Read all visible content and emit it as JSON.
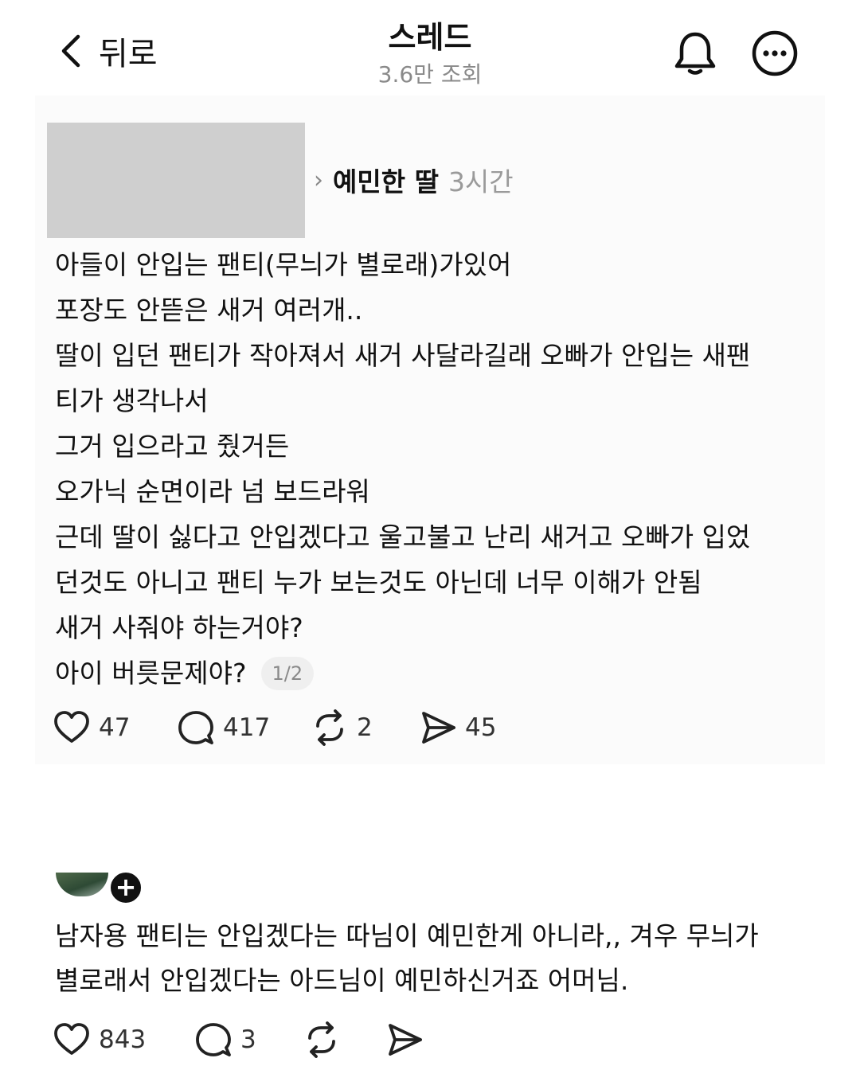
{
  "header": {
    "back_label": "뒤로",
    "title": "스레드",
    "views": "3.6만 조회",
    "bell_icon": "bell-icon",
    "more_icon": "more-icon"
  },
  "post": {
    "author": "예민한 딸",
    "time": "3시간",
    "lines": [
      "아들이 안입는 팬티(무늬가 별로래)가있어",
      "포장도 안뜯은 새거 여러개..",
      "딸이 입던 팬티가 작아져서 새거 사달라길래 오빠가 안입는 새팬",
      "티가 생각나서",
      "그거 입으라고 줬거든",
      "오가닉 순면이라 넘 보드라워",
      "근데 딸이 싫다고 안입겠다고 울고불고 난리 새거고 오빠가 입었",
      "던것도 아니고 팬티 누가 보는것도 아닌데 너무 이해가 안됨",
      "새거 사줘야 하는거야?",
      "아이 버릇문제야?"
    ],
    "page_indicator": "1/2",
    "likes": "47",
    "comments": "417",
    "reposts": "2",
    "shares": "45"
  },
  "comment": {
    "lines": [
      "남자용 팬티는 안입겠다는 따님이 예민한게 아니라,, 겨우 무늬가",
      "별로래서 안입겠다는 아드님이 예민하신거죠 어머님."
    ],
    "likes": "843",
    "comments": "3"
  }
}
